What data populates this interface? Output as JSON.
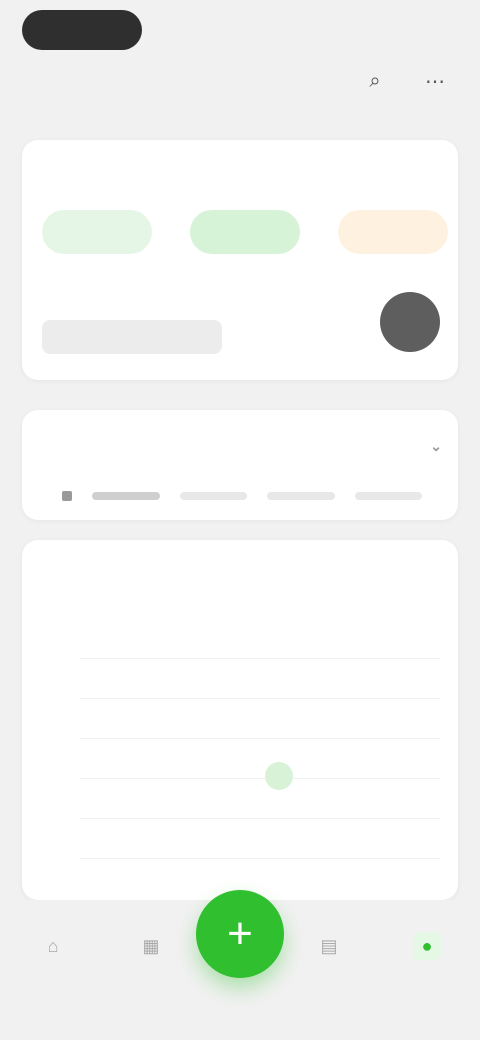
{
  "topbar": {
    "pill_label": "",
    "right_text": "",
    "title": ""
  },
  "icons": {
    "search": "search-icon",
    "more": "more-icon"
  },
  "summary": {
    "title": "",
    "link": "",
    "stats": [
      "",
      "",
      ""
    ],
    "promo_title": "",
    "promo_sub": "",
    "promo_note": ""
  },
  "filter": {
    "title": "",
    "dropdown": ""
  },
  "calendar": {
    "left_head": "",
    "right_head": "",
    "weekday_row": "",
    "time_labels": [
      "",
      "",
      "",
      "",
      "",
      ""
    ]
  },
  "bottom_nav": {
    "items": [
      {
        "label": "",
        "icon": "home-icon"
      },
      {
        "label": "",
        "icon": "calendar-icon"
      },
      {
        "label": "",
        "icon": "chart-icon"
      },
      {
        "label": "",
        "icon": "user-icon"
      }
    ],
    "fab": "+"
  },
  "colors": {
    "accent": "#2fbf2f",
    "accent_light": "#e5f7e5",
    "warning": "#f0a24a",
    "background": "#f1f1f1",
    "card": "#ffffff"
  }
}
